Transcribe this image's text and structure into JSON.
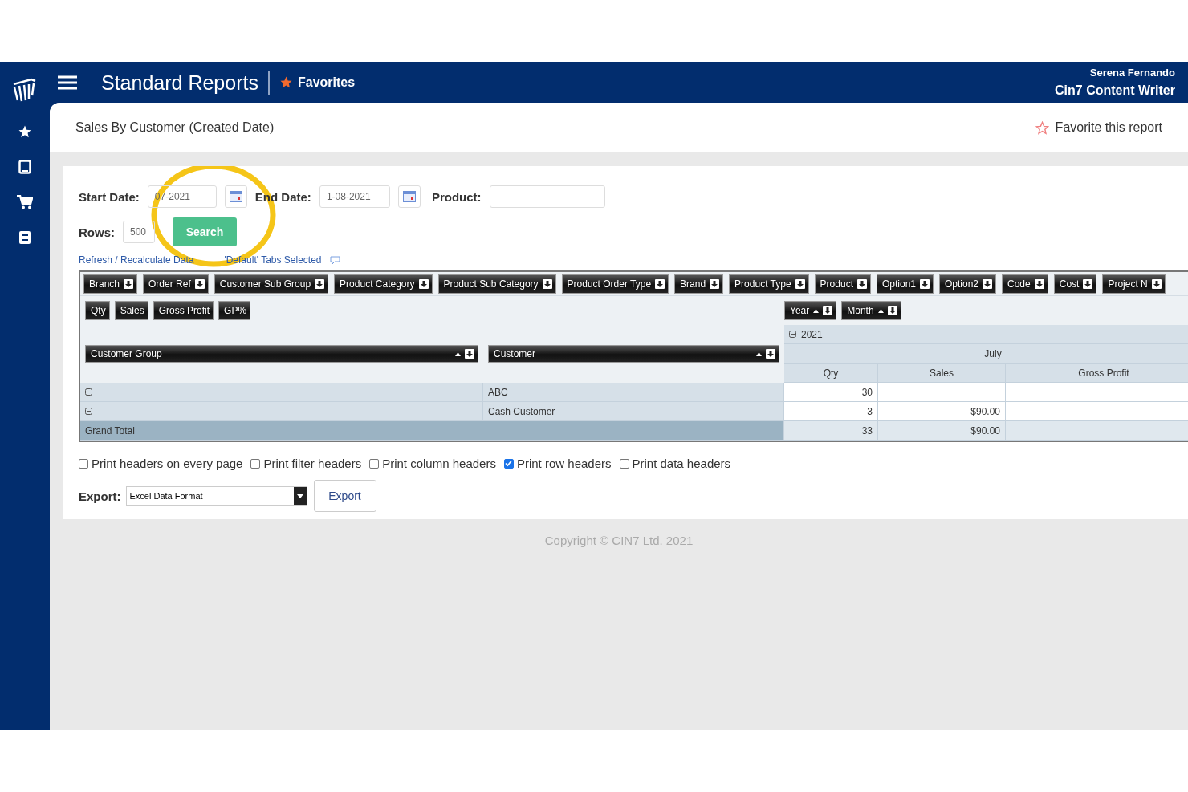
{
  "header": {
    "title": "Standard Reports",
    "favorites": "Favorites",
    "user_name": "Serena Fernando",
    "user_role": "Cin7 Content Writer"
  },
  "report": {
    "title": "Sales By Customer (Created Date)",
    "favorite_action": "Favorite this report"
  },
  "filters": {
    "start_date_label": "Start Date:",
    "start_date": "07-2021",
    "end_date_label": "End Date:",
    "end_date": "1-08-2021",
    "product_label": "Product:",
    "rows_label": "Rows:",
    "rows": "500",
    "search": "Search"
  },
  "links": {
    "refresh": "Refresh / Recalculate Data",
    "tabs_selected": "'Default' Tabs Selected"
  },
  "pivot": {
    "filter_fields": [
      "Branch",
      "Order Ref",
      "Customer Sub Group",
      "Product Category",
      "Product Sub Category",
      "Product Order Type",
      "Brand",
      "Product Type",
      "Product",
      "Option1",
      "Option2",
      "Code",
      "Cost",
      "Project N"
    ],
    "data_fields": [
      "Qty",
      "Sales",
      "Gross Profit",
      "GP%"
    ],
    "column_fields": [
      "Year",
      "Month"
    ],
    "row_fields": [
      "Customer Group",
      "Customer"
    ],
    "year": "2021",
    "month": "July",
    "data_headers": [
      "Qty",
      "Sales",
      "Gross Profit"
    ],
    "rows": [
      {
        "customer": "ABC",
        "qty": "30"
      },
      {
        "customer": "Cash Customer",
        "qty": "3",
        "sales": "$90.00"
      }
    ],
    "grand_total": {
      "label": "Grand Total",
      "qty": "33",
      "sales": "$90.00"
    }
  },
  "print_options": [
    {
      "label": "Print headers on every page",
      "checked": false
    },
    {
      "label": "Print filter headers",
      "checked": false
    },
    {
      "label": "Print column headers",
      "checked": false
    },
    {
      "label": "Print row headers",
      "checked": true
    },
    {
      "label": "Print data headers",
      "checked": false
    }
  ],
  "export": {
    "label": "Export:",
    "format": "Excel Data Format",
    "button": "Export"
  },
  "footer": "Copyright © CIN7 Ltd. 2021"
}
